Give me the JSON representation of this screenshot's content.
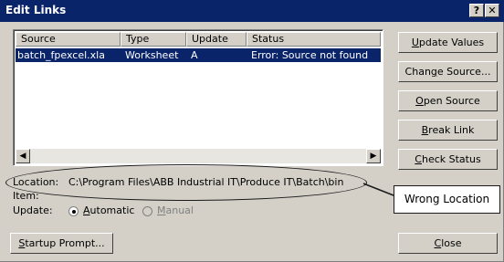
{
  "window": {
    "title": "Edit Links",
    "help_glyph": "?",
    "close_glyph": "✕"
  },
  "list": {
    "columns": [
      "Source",
      "Type",
      "Update",
      "Status"
    ],
    "rows": [
      {
        "source": "batch_fpexcel.xla",
        "type": "Worksheet",
        "update": "A",
        "status": "Error: Source not found",
        "selected": true
      }
    ],
    "scroll_left_glyph": "◀",
    "scroll_right_glyph": "▶"
  },
  "buttons": {
    "update_values": {
      "pre": "",
      "mnemonic": "U",
      "post": "pdate Values"
    },
    "change_source": {
      "pre": "Chan",
      "mnemonic": "g",
      "post": "e Source..."
    },
    "open_source": {
      "pre": "",
      "mnemonic": "O",
      "post": "pen Source"
    },
    "break_link": {
      "pre": "",
      "mnemonic": "B",
      "post": "reak Link"
    },
    "check_status": {
      "pre": "",
      "mnemonic": "C",
      "post": "heck Status"
    },
    "startup_prompt": {
      "pre": "",
      "mnemonic": "S",
      "post": "tartup Prompt..."
    },
    "close": {
      "pre": "",
      "mnemonic": "C",
      "post": "lose"
    }
  },
  "details": {
    "location_label": "Location:",
    "location_value": "C:\\Program Files\\ABB Industrial IT\\Produce IT\\Batch\\bin",
    "item_label": "Item:",
    "update_label": "Update:",
    "automatic": {
      "pre": "",
      "mnemonic": "A",
      "post": "utomatic",
      "checked": true
    },
    "manual": {
      "pre": "",
      "mnemonic": "M",
      "post": "anual",
      "checked": false,
      "disabled": true
    }
  },
  "annotation": {
    "text": "Wrong Location"
  },
  "colors": {
    "selection": "#0a246a",
    "dialog": "#d4d0c8",
    "titlebar": "#0a246a"
  }
}
